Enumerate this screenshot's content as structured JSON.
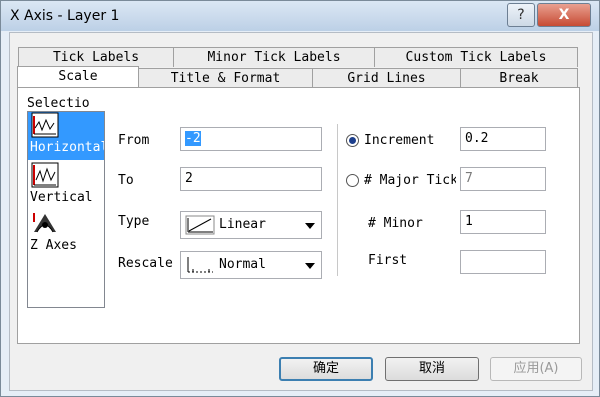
{
  "window": {
    "title": "X Axis - Layer 1",
    "help_label": "?",
    "close_label": "X"
  },
  "tabs_row1": [
    "Tick Labels",
    "Minor Tick Labels",
    "Custom Tick Labels"
  ],
  "tabs_row2": [
    "Scale",
    "Title & Format",
    "Grid Lines",
    "Break"
  ],
  "selection": {
    "label": "Selectio",
    "items": [
      {
        "label": "Horizontal",
        "icon": "horizontal-axis-icon",
        "selected": true
      },
      {
        "label": "Vertical",
        "icon": "vertical-axis-icon",
        "selected": false
      },
      {
        "label": "Z Axes",
        "icon": "z-axes-icon",
        "selected": false
      }
    ]
  },
  "scale": {
    "from_label": "From",
    "from_value": "-2",
    "to_label": "To",
    "to_value": "2",
    "type_label": "Type",
    "type_value": "Linear",
    "rescale_label": "Rescale",
    "rescale_value": "Normal"
  },
  "ticks": {
    "increment_label": "Increment",
    "increment_value": "0.2",
    "increment_checked": true,
    "major_label": "# Major Tick",
    "major_value": "7",
    "major_checked": false,
    "minor_label": "# Minor",
    "minor_value": "1",
    "first_label": "First",
    "first_value": ""
  },
  "buttons": {
    "ok": "确定",
    "cancel": "取消",
    "apply": "应用(A)"
  },
  "colors": {
    "selection_highlight": "#3399ff",
    "close_button": "#c74b34"
  }
}
